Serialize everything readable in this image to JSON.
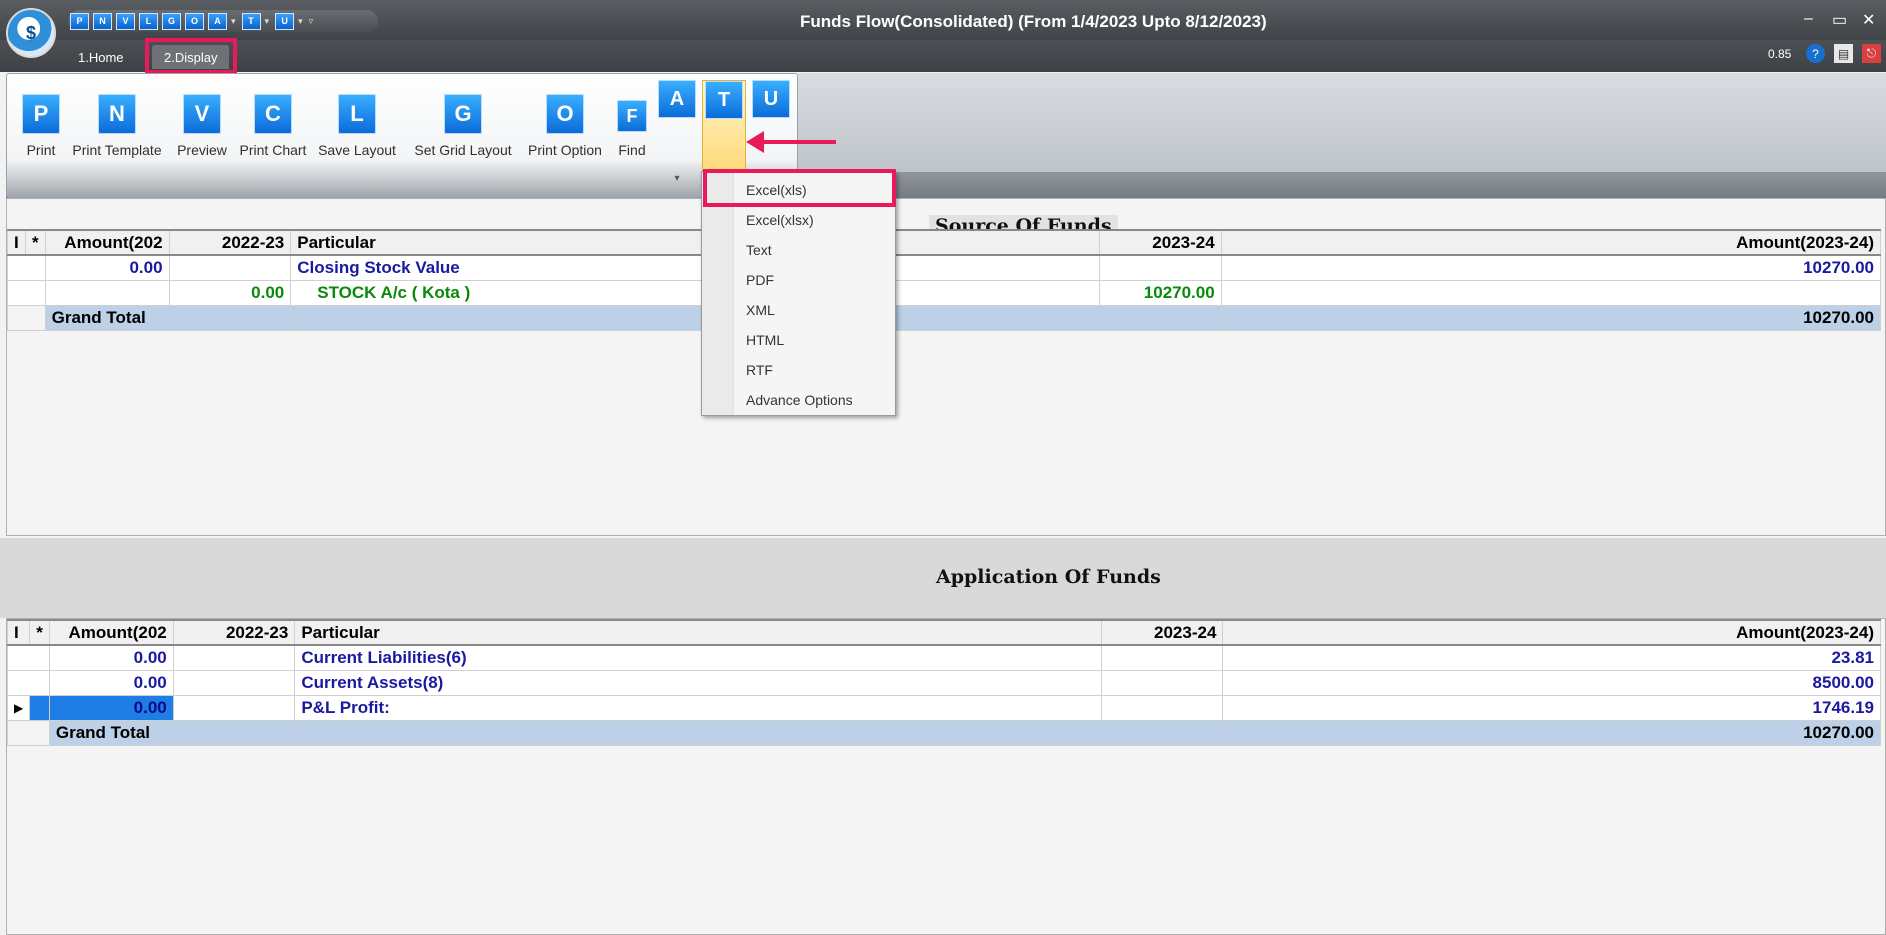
{
  "window": {
    "title": "Funds Flow(Consolidated) (From 1/4/2023 Upto 8/12/2023)",
    "zoom": "0.85"
  },
  "quick_access": [
    "P",
    "N",
    "V",
    "L",
    "G",
    "O",
    "A",
    "T",
    "U"
  ],
  "tabs": [
    {
      "label": "1.Home"
    },
    {
      "label": "2.Display"
    }
  ],
  "ribbon": {
    "buttons": [
      {
        "letter": "P",
        "label": "Print"
      },
      {
        "letter": "N",
        "label": "Print Template"
      },
      {
        "letter": "V",
        "label": "Preview"
      },
      {
        "letter": "C",
        "label": "Print Chart"
      },
      {
        "letter": "L",
        "label": "Save Layout"
      },
      {
        "letter": "G",
        "label": "Set Grid Layout"
      },
      {
        "letter": "O",
        "label": "Print Option"
      },
      {
        "letter": "F",
        "label": "Find"
      }
    ],
    "split_buttons": [
      {
        "letter": "A"
      },
      {
        "letter": "T"
      },
      {
        "letter": "U"
      }
    ]
  },
  "export_menu": {
    "items": [
      "Excel(xls)",
      "Excel(xlsx)",
      "Text",
      "PDF",
      "XML",
      "HTML",
      "RTF",
      "Advance Options"
    ]
  },
  "source_of_funds": {
    "title": "Source Of Funds",
    "headers": [
      "I",
      "*",
      "Amount(202",
      "2022-23",
      "Particular",
      "2023-24",
      "Amount(2023-24)"
    ],
    "rows": [
      {
        "amount_prev": "0.00",
        "prev": "",
        "particular": "Closing Stock Value",
        "curr": "",
        "amount_curr": "10270.00"
      },
      {
        "amount_prev": "",
        "prev": "0.00",
        "particular": "STOCK A/c ( Kota )",
        "curr": "10270.00",
        "amount_curr": ""
      }
    ],
    "total_label": "Grand Total",
    "total_value": "10270.00"
  },
  "application_of_funds": {
    "title": "Application Of Funds",
    "headers": [
      "I",
      "*",
      "Amount(202",
      "2022-23",
      "Particular",
      "2023-24",
      "Amount(2023-24)"
    ],
    "rows": [
      {
        "amount_prev": "0.00",
        "particular": "Current Liabilities(6)",
        "amount_curr": "23.81"
      },
      {
        "amount_prev": "0.00",
        "particular": "Current Assets(8)",
        "amount_curr": "8500.00"
      },
      {
        "amount_prev": "0.00",
        "particular": "P&L Profit:",
        "amount_curr": "1746.19"
      }
    ],
    "total_label": "Grand Total",
    "total_value": "10270.00"
  },
  "colors": {
    "highlight": "#e91a5a",
    "grid_blue_text": "#1a1aa0",
    "grid_green_text": "#0a8a0a",
    "total_row": "#bcd0e8"
  }
}
